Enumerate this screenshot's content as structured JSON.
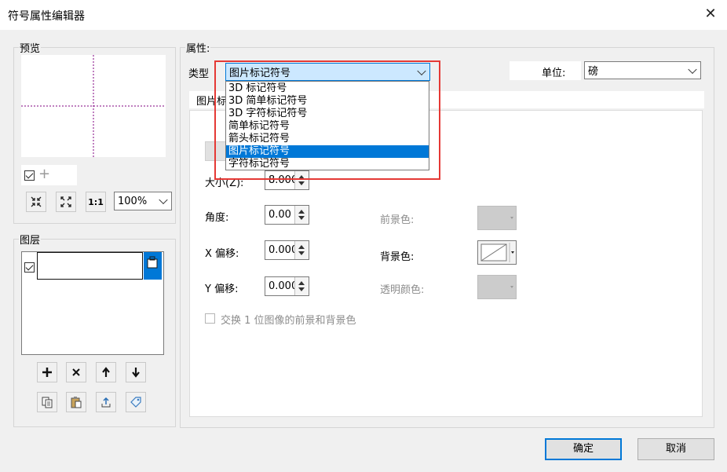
{
  "window": {
    "title": "符号属性编辑器",
    "close_glyph": "✕"
  },
  "preview": {
    "label": "预览",
    "zoom_value": "100%",
    "fit_btn": "1:1"
  },
  "layers": {
    "label": "图层"
  },
  "properties": {
    "label": "属性:",
    "type_label": "类型",
    "type_value": "图片标记符号",
    "unit_label": "单位:",
    "unit_value": "磅",
    "tab_label": "图片标",
    "size_label": "大小(Z):",
    "size_value": "8.000",
    "angle_label": "角度:",
    "angle_value": "0.00",
    "xoffset_label": "X 偏移:",
    "xoffset_value": "0.000",
    "yoffset_label": "Y 偏移:",
    "yoffset_value": "0.000",
    "foreground_label": "前景色:",
    "background_label": "背景色:",
    "transparent_label": "透明颜色:",
    "swap_label": "交换 1 位图像的前景和背景色"
  },
  "dropdown": {
    "options": [
      "3D 标记符号",
      "3D 简单标记符号",
      "3D 字符标记符号",
      "简单标记符号",
      "箭头标记符号",
      "图片标记符号",
      "字符标记符号"
    ],
    "selected_index": 5
  },
  "footer": {
    "ok_label": "确定",
    "cancel_label": "取消"
  },
  "colors": {
    "accent": "#0078d7",
    "highlight_box": "#e53935",
    "guide_line": "#800080"
  }
}
